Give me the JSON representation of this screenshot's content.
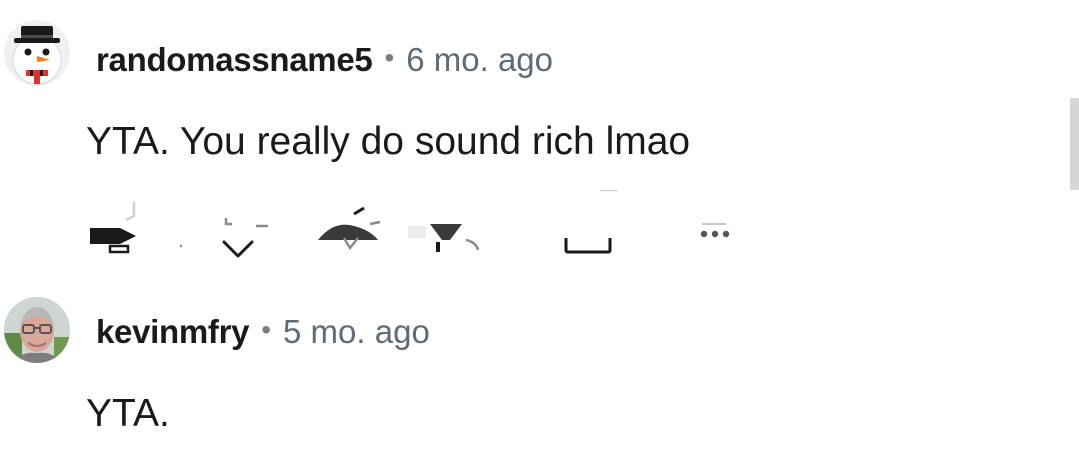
{
  "comments": [
    {
      "username": "randomassname5",
      "separator": "•",
      "age": "6 mo. ago",
      "body": "YTA. You really do sound rich lmao",
      "avatar": "snowman-avatar",
      "actions": [
        "share-icon",
        "downvote-icon",
        "reply-icon",
        "award-icon",
        "save-icon",
        "more-icon"
      ]
    },
    {
      "username": "kevinmfry",
      "separator": "•",
      "age": "5 mo. ago",
      "body": "YTA.",
      "avatar": "user-photo-avatar"
    }
  ],
  "colors": {
    "text": "#1a1a1b",
    "meta": "#5f6b75",
    "icon": "#1a1a1b"
  }
}
